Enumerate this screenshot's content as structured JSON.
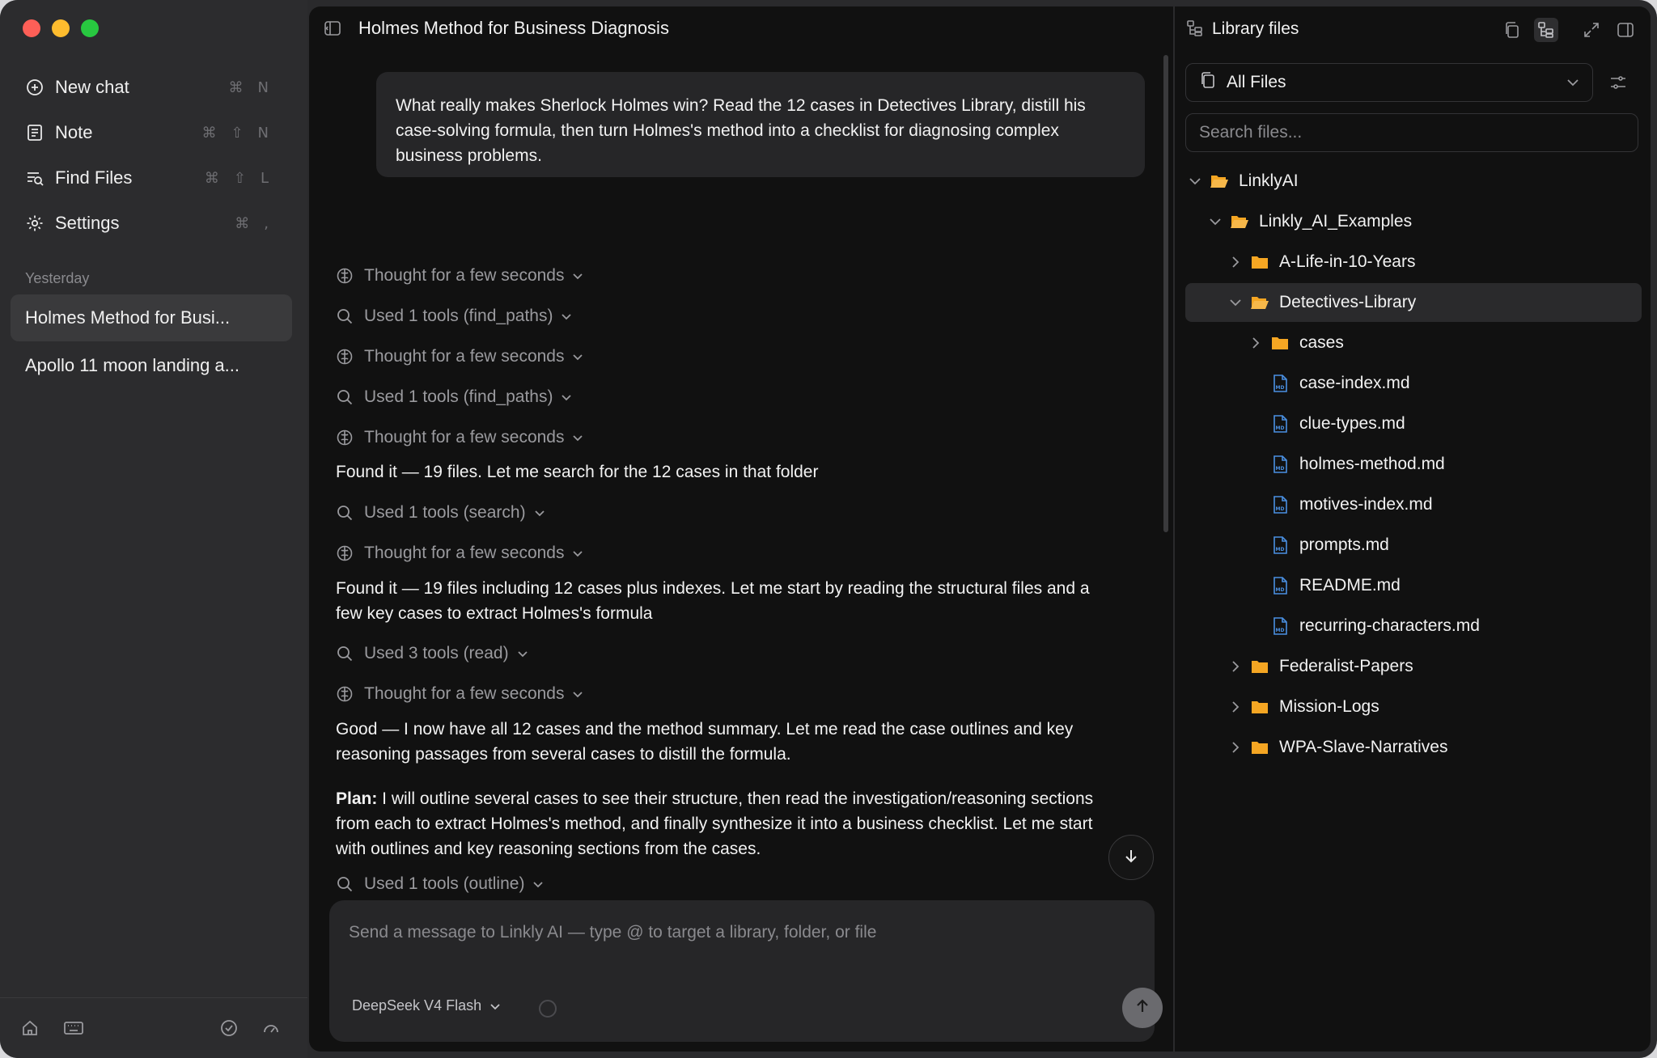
{
  "window": {
    "traffic_lights": [
      "close",
      "minimize",
      "zoom"
    ]
  },
  "sidebar": {
    "menu": [
      {
        "label": "New chat",
        "shortcut": "⌘N",
        "icon": "new-chat-icon"
      },
      {
        "label": "Note",
        "shortcut": "⌘⇧N",
        "icon": "note-icon"
      },
      {
        "label": "Find Files",
        "shortcut": "⌘⇧L",
        "icon": "find-files-icon"
      },
      {
        "label": "Settings",
        "shortcut": "⌘,",
        "icon": "gear-icon"
      }
    ],
    "section_label": "Yesterday",
    "chats": [
      {
        "title": "Holmes Method for Busi..."
      },
      {
        "title": "Apollo 11 moon landing a..."
      }
    ],
    "bottom_icons": [
      "home-icon",
      "keyboard-icon",
      "check-circle-icon",
      "gauge-icon"
    ]
  },
  "main": {
    "title": "Holmes Method for Business Diagnosis",
    "user_message": "What really makes Sherlock Holmes win? Read the 12 cases in Detectives Library, distill his case-solving formula, then turn Holmes's method into a checklist for diagnosing complex business problems.",
    "steps": {
      "s1": "Thought for a few seconds",
      "s2": "Used 1 tools (find_paths)",
      "s3": "Thought for a few seconds",
      "s4": "Used 1 tools (find_paths)",
      "s5": "Thought for a few seconds",
      "s6": "Used 1 tools (search)",
      "s7": "Thought for a few seconds",
      "s8": "Used 3 tools (read)",
      "s9": "Thought for a few seconds",
      "s10": "Used 1 tools (outline)"
    },
    "messages": {
      "m1": "Found it — 19 files. Let me search for the 12 cases in that folder",
      "m2": "Found it — 19 files including 12 cases plus indexes. Let me start by reading the structural files and a few key cases to extract Holmes's formula",
      "m3": "Good — I now have all 12 cases and the method summary. Let me read the case outlines and key reasoning passages from several cases to distill the formula.",
      "plan_label": "Plan:",
      "plan_text": " I will outline several cases to see their structure, then read the investigation/reasoning sections from each to extract Holmes's method, and finally synthesize it into a business checklist. Let me start with outlines and key reasoning sections from the cases."
    },
    "composer": {
      "placeholder": "Send a message to Linkly AI — type @ to target a library, folder, or file",
      "value": "",
      "model": "DeepSeek V4 Flash"
    }
  },
  "files_panel": {
    "title": "Library files",
    "scope": "All Files",
    "search_placeholder": "Search files...",
    "tree": [
      {
        "name": "LinklyAI",
        "type": "folder",
        "expanded": true
      },
      {
        "name": "Linkly_AI_Examples",
        "type": "folder",
        "expanded": true
      },
      {
        "name": "A-Life-in-10-Years",
        "type": "folder",
        "expanded": false
      },
      {
        "name": "Detectives-Library",
        "type": "folder",
        "expanded": true,
        "selected": true
      },
      {
        "name": "cases",
        "type": "folder",
        "expanded": false
      },
      {
        "name": "case-index.md",
        "type": "file"
      },
      {
        "name": "clue-types.md",
        "type": "file"
      },
      {
        "name": "holmes-method.md",
        "type": "file"
      },
      {
        "name": "motives-index.md",
        "type": "file"
      },
      {
        "name": "prompts.md",
        "type": "file"
      },
      {
        "name": "README.md",
        "type": "file"
      },
      {
        "name": "recurring-characters.md",
        "type": "file"
      },
      {
        "name": "Federalist-Papers",
        "type": "folder",
        "expanded": false
      },
      {
        "name": "Mission-Logs",
        "type": "folder",
        "expanded": false
      },
      {
        "name": "WPA-Slave-Narratives",
        "type": "folder",
        "expanded": false
      }
    ]
  },
  "colors": {
    "folder": "#f5a623",
    "file_icon": "#4a90e2",
    "background_main": "#111111",
    "background_sidebar": "#2c2c2e"
  }
}
